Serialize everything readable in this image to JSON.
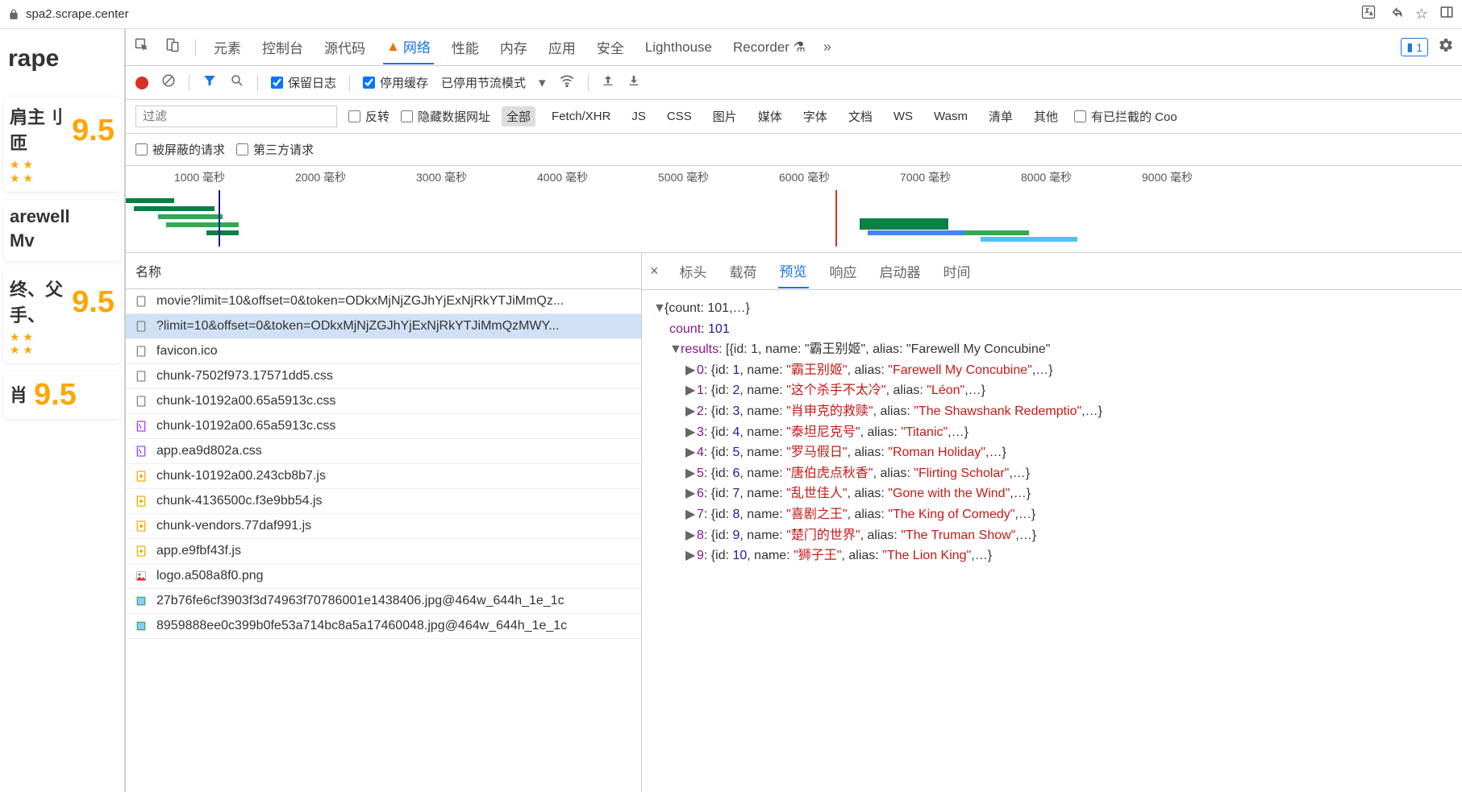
{
  "url": "spa2.scrape.center",
  "brand": "rape",
  "cards": [
    {
      "partial": "肩主刂匝",
      "rating": "9.5"
    },
    {
      "partial": "arewell",
      "sub": "Mv",
      "rating": ""
    },
    {
      "partial": "终、父手、",
      "rating": "9.5"
    },
    {
      "partial": "肖",
      "rating": "9.5"
    }
  ],
  "devtabs": {
    "elements": "元素",
    "console": "控制台",
    "sources": "源代码",
    "network": "网络",
    "performance": "性能",
    "memory": "内存",
    "application": "应用",
    "security": "安全",
    "lighthouse": "Lighthouse",
    "recorder": "Recorder"
  },
  "badge_count": "1",
  "toolbar": {
    "preserve_log": "保留日志",
    "disable_cache": "停用缓存",
    "throttling": "已停用节流模式"
  },
  "filterbar": {
    "filter_placeholder": "过滤",
    "invert": "反转",
    "hide_data": "隐藏数据网址",
    "all": "全部",
    "fetch": "Fetch/XHR",
    "js": "JS",
    "css": "CSS",
    "img": "图片",
    "media": "媒体",
    "font": "字体",
    "doc": "文档",
    "ws": "WS",
    "wasm": "Wasm",
    "manifest": "清单",
    "other": "其他",
    "blocked": "有已拦截的 Coo"
  },
  "filterbar2": {
    "blocked_req": "被屏蔽的请求",
    "third_party": "第三方请求"
  },
  "timeline_ticks": [
    "1000 毫秒",
    "2000 毫秒",
    "3000 毫秒",
    "4000 毫秒",
    "5000 毫秒",
    "6000 毫秒",
    "7000 毫秒",
    "8000 毫秒",
    "9000 毫秒"
  ],
  "req_header": "名称",
  "requests": [
    {
      "icon": "doc",
      "name": "movie?limit=10&offset=0&token=ODkxMjNjZGJhYjExNjRkYTJiMmQz..."
    },
    {
      "icon": "doc",
      "name": "?limit=10&offset=0&token=ODkxMjNjZGJhYjExNjRkYTJiMmQzMWY...",
      "selected": true
    },
    {
      "icon": "doc",
      "name": "favicon.ico"
    },
    {
      "icon": "css",
      "name": "chunk-7502f973.17571dd5.css"
    },
    {
      "icon": "css",
      "name": "chunk-10192a00.65a5913c.css"
    },
    {
      "icon": "cssp",
      "name": "chunk-10192a00.65a5913c.css"
    },
    {
      "icon": "cssp",
      "name": "app.ea9d802a.css"
    },
    {
      "icon": "js",
      "name": "chunk-10192a00.243cb8b7.js"
    },
    {
      "icon": "js",
      "name": "chunk-4136500c.f3e9bb54.js"
    },
    {
      "icon": "js",
      "name": "chunk-vendors.77daf991.js"
    },
    {
      "icon": "js",
      "name": "app.e9fbf43f.js"
    },
    {
      "icon": "img",
      "name": "logo.a508a8f0.png"
    },
    {
      "icon": "img2",
      "name": "27b76fe6cf3903f3d74963f70786001e1438406.jpg@464w_644h_1e_1c"
    },
    {
      "icon": "img2",
      "name": "8959888ee0c399b0fe53a714bc8a5a17460048.jpg@464w_644h_1e_1c"
    }
  ],
  "detail_tabs": {
    "headers": "标头",
    "payload": "载荷",
    "preview": "预览",
    "response": "响应",
    "initiator": "启动器",
    "timing": "时间"
  },
  "json": {
    "count_label": "count",
    "count_value": "101",
    "results_label": "results",
    "top_summary": "{count: 101,…}",
    "results_summary": "[{id: 1, name: \"霸王别姬\", alias: \"Farewell My Concubine\"",
    "items": [
      {
        "idx": "0",
        "id": "1",
        "name": "霸王别姬",
        "alias": "Farewell My Concubine"
      },
      {
        "idx": "1",
        "id": "2",
        "name": "这个杀手不太冷",
        "alias": "Léon"
      },
      {
        "idx": "2",
        "id": "3",
        "name": "肖申克的救赎",
        "alias": "The Shawshank Redemptio"
      },
      {
        "idx": "3",
        "id": "4",
        "name": "泰坦尼克号",
        "alias": "Titanic"
      },
      {
        "idx": "4",
        "id": "5",
        "name": "罗马假日",
        "alias": "Roman Holiday"
      },
      {
        "idx": "5",
        "id": "6",
        "name": "唐伯虎点秋香",
        "alias": "Flirting Scholar"
      },
      {
        "idx": "6",
        "id": "7",
        "name": "乱世佳人",
        "alias": "Gone with the Wind"
      },
      {
        "idx": "7",
        "id": "8",
        "name": "喜剧之王",
        "alias": "The King of Comedy"
      },
      {
        "idx": "8",
        "id": "9",
        "name": "楚门的世界",
        "alias": "The Truman Show"
      },
      {
        "idx": "9",
        "id": "10",
        "name": "狮子王",
        "alias": "The Lion King"
      }
    ]
  }
}
